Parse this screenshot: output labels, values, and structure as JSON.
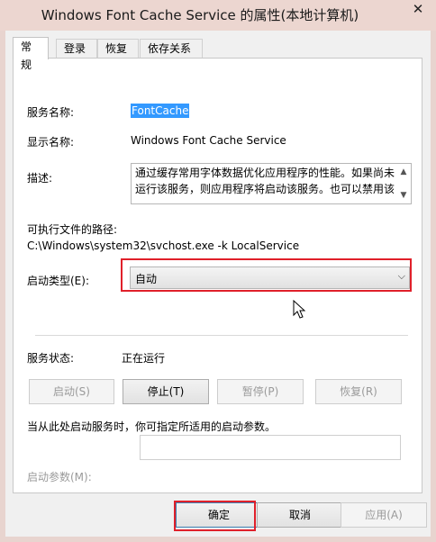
{
  "window": {
    "title": "Windows Font Cache Service 的属性(本地计算机)",
    "close_glyph": "✕"
  },
  "tabs": [
    {
      "label": "常规",
      "active": true
    },
    {
      "label": "登录",
      "active": false
    },
    {
      "label": "恢复",
      "active": false
    },
    {
      "label": "依存关系",
      "active": false
    }
  ],
  "general": {
    "service_name_label": "服务名称:",
    "service_name_value": "FontCache",
    "display_name_label": "显示名称:",
    "display_name_value": "Windows Font Cache Service",
    "description_label": "描述:",
    "description_value": "通过缓存常用字体数据优化应用程序的性能。如果尚未运行该服务，则应用程序将启动该服务。也可以禁用该",
    "path_label": "可执行文件的路径:",
    "path_value": "C:\\Windows\\system32\\svchost.exe -k LocalService",
    "startup_type_label": "启动类型(E):",
    "startup_type_value": "自动",
    "status_label": "服务状态:",
    "status_value": "正在运行",
    "start_button": "启动(S)",
    "stop_button": "停止(T)",
    "pause_button": "暂停(P)",
    "resume_button": "恢复(R)",
    "params_hint": "当从此处启动服务时，你可指定所适用的启动参数。",
    "params_label": "启动参数(M):",
    "params_value": ""
  },
  "footer": {
    "ok_button": "确定",
    "cancel_button": "取消",
    "apply_button": "应用(A)"
  },
  "colors": {
    "highlight": "#e0202a",
    "selection": "#3399ff"
  }
}
